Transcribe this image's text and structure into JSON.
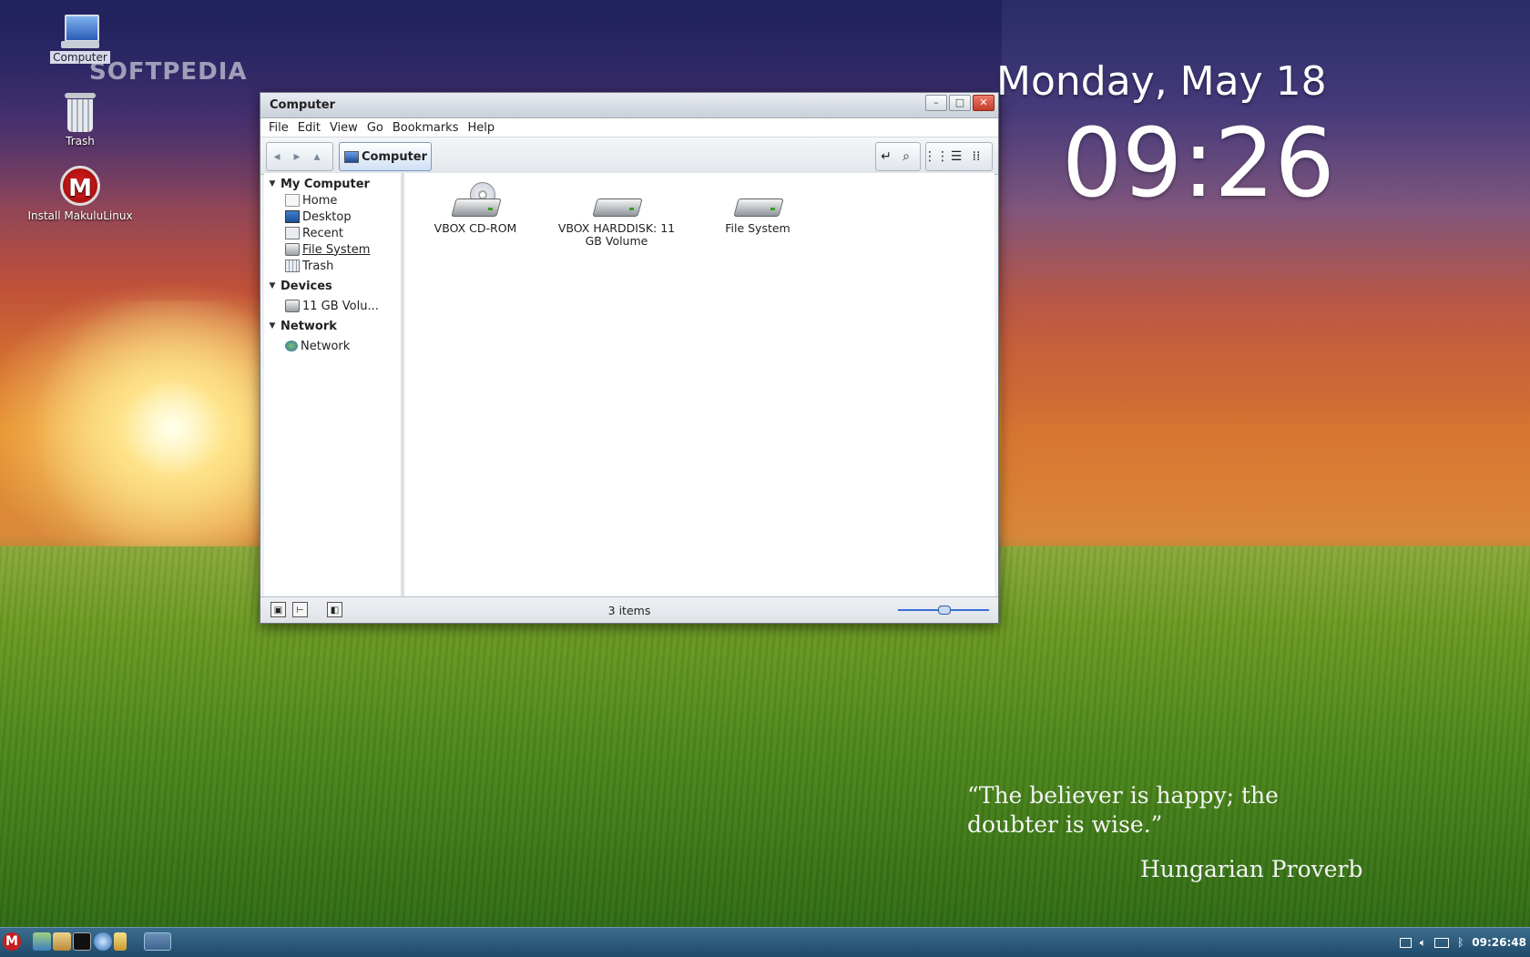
{
  "desktop": {
    "watermark": "SOFTPEDIA",
    "icons": [
      {
        "label": "Computer",
        "icon": "computer-icon"
      },
      {
        "label": "Trash",
        "icon": "trash-icon"
      },
      {
        "label": "Install MakuluLinux",
        "icon": "makulu-install-icon",
        "glyph": "M"
      }
    ]
  },
  "clock_widget": {
    "date": "Monday, May 18",
    "time": "09:26"
  },
  "quote_widget": {
    "quote": "“The believer is happy; the doubter is wise.”",
    "author": "Hungarian Proverb"
  },
  "window": {
    "title": "Computer",
    "controls": [
      "–",
      "□",
      "✕"
    ],
    "menu": [
      "File",
      "Edit",
      "View",
      "Go",
      "Bookmarks",
      "Help"
    ],
    "toolbar": {
      "back_icon": "back-arrow-icon",
      "forward_icon": "forward-arrow-icon",
      "up_icon": "up-arrow-icon",
      "location": "Computer",
      "right_buttons": [
        "toggle-location-icon",
        "search-icon",
        "icon-view-icon",
        "list-view-icon",
        "compact-view-icon"
      ]
    },
    "sidebar": {
      "sections": [
        {
          "title": "My Computer",
          "items": [
            {
              "label": "Home",
              "icon": "home-icon"
            },
            {
              "label": "Desktop",
              "icon": "desktop-icon"
            },
            {
              "label": "Recent",
              "icon": "recent-icon"
            },
            {
              "label": "File System",
              "icon": "drive-icon"
            },
            {
              "label": "Trash",
              "icon": "trash-icon"
            }
          ]
        },
        {
          "title": "Devices",
          "items": [
            {
              "label": "11 GB Volu...",
              "icon": "drive-icon"
            }
          ]
        },
        {
          "title": "Network",
          "items": [
            {
              "label": "Network",
              "icon": "network-icon"
            }
          ]
        }
      ]
    },
    "files": [
      {
        "label": "VBOX CD-ROM",
        "icon": "cdrom-icon"
      },
      {
        "label": "VBOX HARDDISK: 11 GB Volume",
        "icon": "harddisk-icon"
      },
      {
        "label": "File System",
        "icon": "harddisk-icon"
      }
    ],
    "statusbar": {
      "count": "3 items"
    }
  },
  "taskbar": {
    "menu_glyph": "M",
    "clock": "09:26:48"
  },
  "colors": {
    "taskbar": "#2a5a7c",
    "accent": "#3a6fd8",
    "close_button": "#c23c27"
  }
}
